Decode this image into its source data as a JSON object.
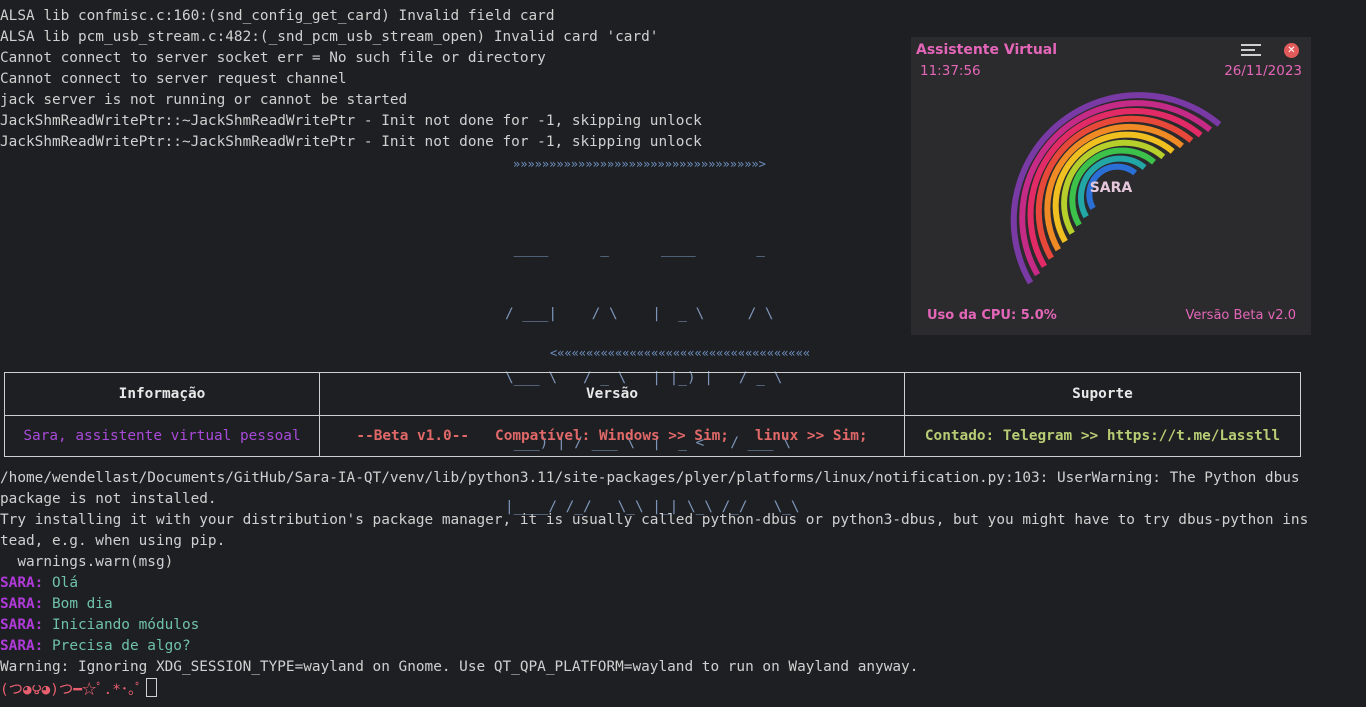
{
  "terminal": {
    "log_lines": [
      "ALSA lib confmisc.c:160:(snd_config_get_card) Invalid field card",
      "ALSA lib pcm_usb_stream.c:482:(_snd_pcm_usb_stream_open) Invalid card 'card'",
      "Cannot connect to server socket err = No such file or directory",
      "Cannot connect to server request channel",
      "jack server is not running or cannot be started",
      "JackShmReadWritePtr::~JackShmReadWritePtr - Init not done for -1, skipping unlock",
      "JackShmReadWritePtr::~JackShmReadWritePtr - Init not done for -1, skipping unlock"
    ],
    "banner_top": "»»»»»»»»»»»»»»»»»»»»»»»»»»»»»»»»»»>",
    "ascii_art": [
      " ____      _      ____       _",
      "/ ___|    / \\    |  _ \\     / \\",
      "\\___ \\   / _ \\   | |_) |   / _ \\",
      " ___) | / ___ \\  |  _ <   / ___ \\",
      "|____/ /_/   \\_\\ |_| \\_\\ /_/   \\_\\"
    ],
    "banner_bottom": "<«««««««««««««««««««««««««««««««««««",
    "table": {
      "headers": [
        "Informação",
        "Versão",
        "Suporte"
      ],
      "row": [
        "Sara, assistente virtual pessoal",
        "--Beta v1.0--   Compatível: Windows >> Sim;   linux >> Sim;",
        "Contado: Telegram >> https://t.me/Lasstll"
      ]
    },
    "warning_lines": [
      "/home/wendellast/Documents/GitHub/Sara-IA-QT/venv/lib/python3.11/site-packages/plyer/platforms/linux/notification.py:103: UserWarning: The Python dbus",
      "package is not installed.",
      "Try installing it with your distribution's package manager, it is usually called python-dbus or python3-dbus, but you might have to try dbus-python ins",
      "tead, e.g. when using pip.",
      "  warnings.warn(msg)"
    ],
    "chat": [
      {
        "speaker": "SARA:",
        "text": " Olá"
      },
      {
        "speaker": "SARA:",
        "text": " Bom dia"
      },
      {
        "speaker": "SARA:",
        "text": " Iniciando módulos"
      },
      {
        "speaker": "SARA:",
        "text": " Precisa de algo?"
      }
    ],
    "final_warning": "Warning: Ignoring XDG_SESSION_TYPE=wayland on Gnome. Use QT_QPA_PLATFORM=wayland to run on Wayland anyway.",
    "prompt_face": "(つ◕౪◕)つ━☆ﾟ.*･｡ﾟ"
  },
  "widget": {
    "title": "Assistente Virtual",
    "time": "11:37:56",
    "date": "26/11/2023",
    "center_label": "SARA",
    "cpu_label": "Uso da CPU: 5.0%",
    "version_label": "Versão Beta v2.0",
    "ring_colors": [
      "#2a6fd6",
      "#22a6a6",
      "#3cc24a",
      "#b7cf2a",
      "#f0c020",
      "#f08a24",
      "#e8483a",
      "#e22a66",
      "#c42a86",
      "#7a3aa6"
    ],
    "accent": "#e466b8"
  }
}
